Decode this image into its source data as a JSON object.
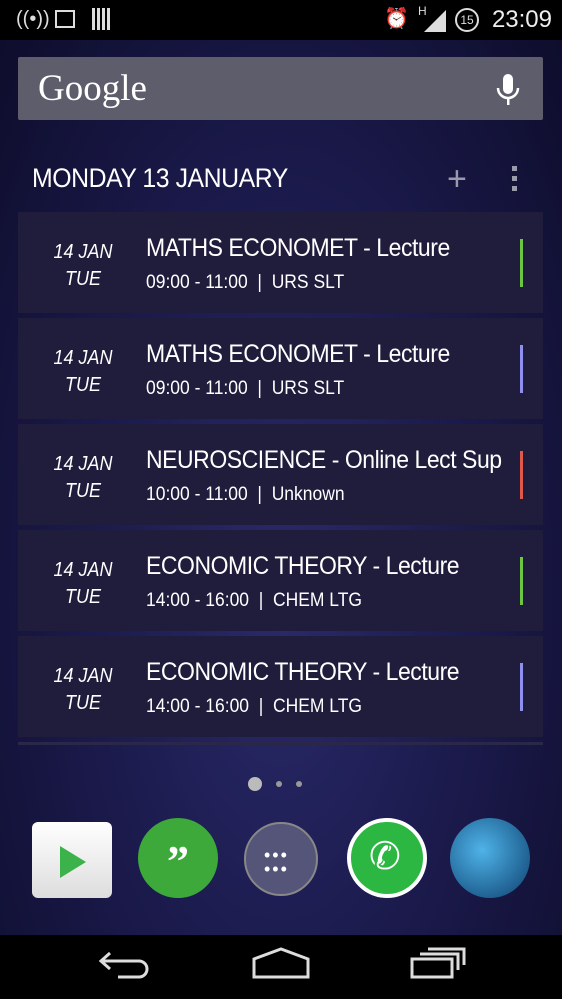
{
  "status_bar": {
    "time": "23:09",
    "notification_badge": "15",
    "network": "H",
    "icons": [
      "wifi-hotspot-icon",
      "image-icon",
      "barcode-icon",
      "alarm-icon",
      "signal-icon",
      "battery-icon"
    ]
  },
  "search": {
    "logo": "Google",
    "icon": "mic-icon"
  },
  "agenda": {
    "header": "MONDAY 13 JANUARY",
    "add_icon": "plus-icon",
    "menu_icon": "more-vert-icon",
    "events": [
      {
        "date": "14 JAN",
        "day": "TUE",
        "title": "MATHS ECONOMET - Lecture",
        "details": "09:00 - 11:00  |  URS SLT",
        "color": "#6cc644"
      },
      {
        "date": "14 JAN",
        "day": "TUE",
        "title": "MATHS ECONOMET - Lecture",
        "details": "09:00 - 11:00  |  URS SLT",
        "color": "#8f8ff0"
      },
      {
        "date": "14 JAN",
        "day": "TUE",
        "title": "NEUROSCIENCE - Online Lect Sup",
        "details": "10:00 - 11:00  |  Unknown",
        "color": "#e0584a"
      },
      {
        "date": "14 JAN",
        "day": "TUE",
        "title": "ECONOMIC THEORY - Lecture",
        "details": "14:00 - 16:00  |  CHEM LTG",
        "color": "#6cc644"
      },
      {
        "date": "14 JAN",
        "day": "TUE",
        "title": "ECONOMIC THEORY - Lecture",
        "details": "14:00 - 16:00  |  CHEM LTG",
        "color": "#8f8ff0"
      }
    ]
  },
  "pager": {
    "pages": 3,
    "current": 1
  },
  "dock": [
    "Play Store",
    "Hangouts",
    "Apps",
    "WhatsApp",
    "Browser"
  ],
  "nav": [
    "back-icon",
    "home-icon",
    "recents-icon"
  ]
}
